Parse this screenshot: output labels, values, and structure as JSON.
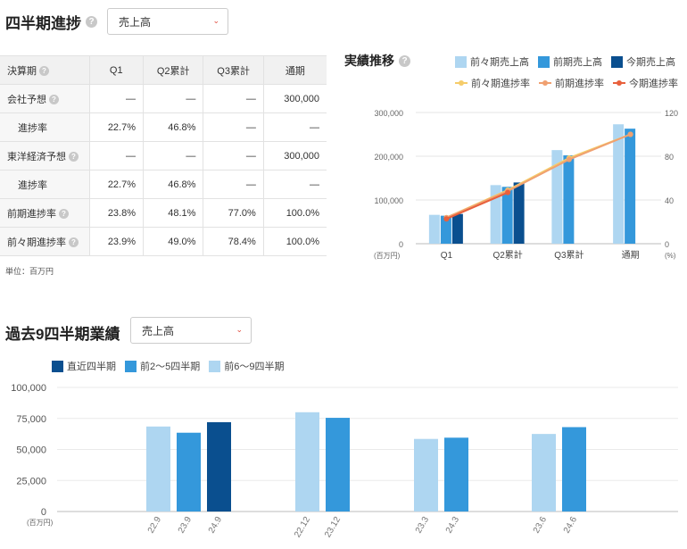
{
  "quarter_progress": {
    "title": "四半期進捗",
    "select_value": "売上高",
    "table": {
      "header": [
        "決算期",
        "Q1",
        "Q2累計",
        "Q3累計",
        "通期"
      ],
      "rows": [
        {
          "label": "会社予想",
          "help": true,
          "sub": false,
          "cells": [
            "—",
            "—",
            "—",
            "300,000"
          ]
        },
        {
          "label": "進捗率",
          "help": false,
          "sub": true,
          "cells": [
            "22.7%",
            "46.8%",
            "—",
            "—"
          ]
        },
        {
          "label": "東洋経済予想",
          "help": true,
          "sub": false,
          "cells": [
            "—",
            "—",
            "—",
            "300,000"
          ]
        },
        {
          "label": "進捗率",
          "help": false,
          "sub": true,
          "cells": [
            "22.7%",
            "46.8%",
            "—",
            "—"
          ]
        },
        {
          "label": "前期進捗率",
          "help": true,
          "sub": false,
          "cells": [
            "23.8%",
            "48.1%",
            "77.0%",
            "100.0%"
          ]
        },
        {
          "label": "前々期進捗率",
          "help": true,
          "sub": false,
          "cells": [
            "23.9%",
            "49.0%",
            "78.4%",
            "100.0%"
          ]
        }
      ]
    },
    "unit_note": "単位：百万円"
  },
  "results_trend": {
    "title": "実績推移",
    "legend_bars": [
      "前々期売上高",
      "前期売上高",
      "今期売上高"
    ],
    "legend_lines": [
      "前々期進捗率",
      "前期進捗率",
      "今期進捗率"
    ],
    "colors": {
      "bar_prev2": "#aed6f1",
      "bar_prev": "#3498db",
      "bar_current": "#0a4f8f",
      "line_prev2": "#f5cc6a",
      "line_prev": "#f0a070",
      "line_current": "#e8603c"
    },
    "left_unit": "(百万円)",
    "right_unit": "(%)"
  },
  "past_quarters": {
    "title": "過去9四半期業績",
    "select_value": "売上高",
    "legend": [
      "直近四半期",
      "前2〜5四半期",
      "前6〜9四半期"
    ],
    "colors": {
      "recent": "#0a4f8f",
      "q2_5": "#3498db",
      "q6_9": "#aed6f1"
    },
    "y_unit": "(百万円)"
  },
  "chart_data": [
    {
      "type": "bar",
      "title": "実績推移",
      "categories": [
        "Q1",
        "Q2累計",
        "Q3累計",
        "通期"
      ],
      "series": [
        {
          "name": "前々期売上高",
          "values": [
            66000,
            134000,
            214000,
            273000
          ]
        },
        {
          "name": "前期売上高",
          "values": [
            64000,
            130000,
            202000,
            263000
          ]
        },
        {
          "name": "今期売上高",
          "values": [
            68000,
            140000,
            null,
            null
          ]
        }
      ],
      "line_series": [
        {
          "name": "前々期進捗率",
          "values": [
            23.9,
            49.0,
            78.4,
            100.0
          ]
        },
        {
          "name": "前期進捗率",
          "values": [
            23.8,
            48.1,
            77.0,
            100.0
          ]
        },
        {
          "name": "今期進捗率",
          "values": [
            22.7,
            46.8,
            null,
            null
          ]
        }
      ],
      "ylim": [
        0,
        300000
      ],
      "y_ticks": [
        "0",
        "100,000",
        "200,000",
        "300,000"
      ],
      "y2lim": [
        0,
        120
      ],
      "y2_ticks": [
        "0",
        "40",
        "80",
        "120"
      ],
      "grid": true
    },
    {
      "type": "bar",
      "title": "過去9四半期業績",
      "groups": [
        {
          "items": [
            {
              "label": "22.9",
              "value": 68500,
              "kind": "q6_9"
            },
            {
              "label": "23.9",
              "value": 63500,
              "kind": "q2_5"
            },
            {
              "label": "24.9",
              "value": 72000,
              "kind": "recent"
            }
          ]
        },
        {
          "items": [
            {
              "label": "22.12",
              "value": 80000,
              "kind": "q6_9"
            },
            {
              "label": "23.12",
              "value": 75500,
              "kind": "q2_5"
            }
          ]
        },
        {
          "items": [
            {
              "label": "23.3",
              "value": 58500,
              "kind": "q6_9"
            },
            {
              "label": "24.3",
              "value": 59500,
              "kind": "q2_5"
            }
          ]
        },
        {
          "items": [
            {
              "label": "23.6",
              "value": 62500,
              "kind": "q6_9"
            },
            {
              "label": "24.6",
              "value": 68000,
              "kind": "q2_5"
            }
          ]
        }
      ],
      "ylim": [
        0,
        100000
      ],
      "y_ticks": [
        "0",
        "25,000",
        "50,000",
        "75,000",
        "100,000"
      ],
      "grid": true
    }
  ]
}
